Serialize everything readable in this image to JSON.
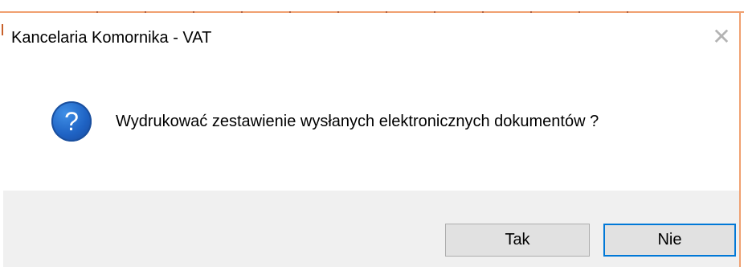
{
  "dialog": {
    "title": "Kancelaria Komornika - VAT",
    "close_symbol": "✕",
    "icon": "question-icon",
    "icon_glyph": "?",
    "message": "Wydrukować zestawienie wysłanych elektronicznych dokumentów ?",
    "buttons": {
      "yes_label": "Tak",
      "no_label": "Nie"
    }
  },
  "colors": {
    "accent": "#0078d7",
    "icon_blue": "#1f63c4",
    "footer_bg": "#f0f0f0",
    "frame": "#f0a070"
  }
}
